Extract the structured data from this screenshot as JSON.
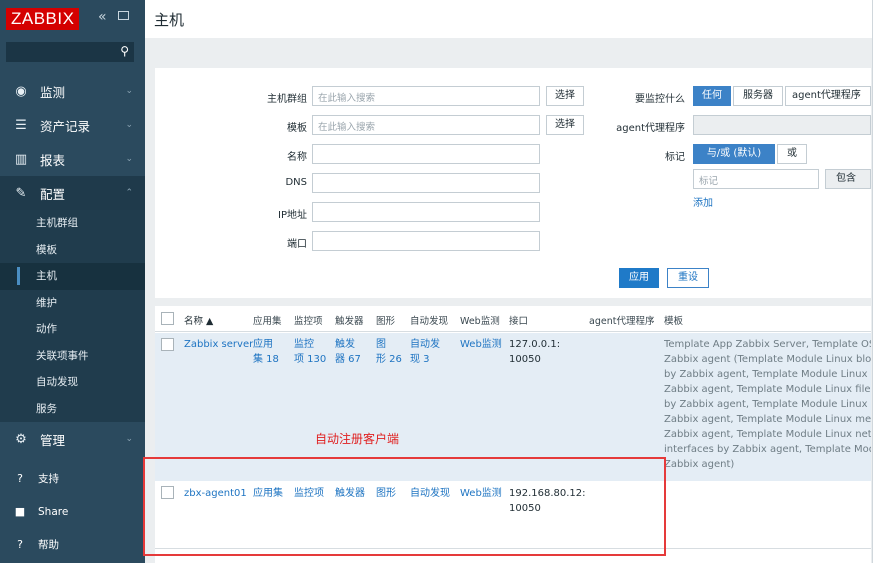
{
  "sidebar": {
    "logo": "ZABBIX",
    "nav": [
      {
        "label": "监测",
        "icon": "eye-icon"
      },
      {
        "label": "资产记录",
        "icon": "list-icon"
      },
      {
        "label": "报表",
        "icon": "bar-chart-icon"
      },
      {
        "label": "配置",
        "icon": "wrench-icon"
      }
    ],
    "config_sub": [
      "主机群组",
      "模板",
      "主机",
      "维护",
      "动作",
      "关联项事件",
      "自动发现",
      "服务"
    ],
    "admin": {
      "label": "管理",
      "icon": "gear-icon"
    },
    "bottom": [
      {
        "label": "支持",
        "icon": "support-icon"
      },
      {
        "label": "Share",
        "icon": "share-icon"
      },
      {
        "label": "帮助",
        "icon": "help-icon"
      }
    ]
  },
  "page": {
    "title": "主机"
  },
  "filter": {
    "host_group_label": "主机群组",
    "host_group_placeholder": "在此输入搜索",
    "select_btn": "选择",
    "template_label": "模板",
    "template_placeholder": "在此输入搜索",
    "name_label": "名称",
    "dns_label": "DNS",
    "ip_label": "IP地址",
    "port_label": "端口",
    "monitored_by_label": "要监控什么",
    "monitored_by_options": [
      "任何",
      "服务器",
      "agent代理程序"
    ],
    "proxy_label": "agent代理程序",
    "tags_label": "标记",
    "tags_options": [
      "与/或 (默认)",
      "或"
    ],
    "tag_placeholder": "标记",
    "tag_operator": "包含",
    "add_link": "添加",
    "apply_btn": "应用",
    "reset_btn": "重设"
  },
  "table": {
    "headers": [
      "名称 ▲",
      "应用集",
      "监控项",
      "触发器",
      "图形",
      "自动发现",
      "Web监测",
      "接口",
      "agent代理程序",
      "模板"
    ],
    "rows": [
      {
        "name": "Zabbix server",
        "apps": [
          "应用",
          "集 18"
        ],
        "items": [
          "监控",
          "项 130"
        ],
        "triggers": [
          "触发",
          "器 67"
        ],
        "graphs": [
          "图",
          "形 26"
        ],
        "discovery": [
          "自动发",
          "现 3"
        ],
        "web": "Web监测",
        "iface": [
          "127.0.0.1:",
          "10050"
        ],
        "templates": [
          "Template App Zabbix Server, Template OS",
          "Zabbix agent (Template Module Linux bloc",
          "by Zabbix agent, Template Module Linux C",
          "Zabbix agent, Template Module Linux files",
          "by Zabbix agent, Template Module Linux g",
          "Zabbix agent, Template Module Linux mem",
          "Zabbix agent, Template Module Linux netw",
          "interfaces by Zabbix agent, Template Modu",
          "Zabbix agent)"
        ]
      },
      {
        "name": "zbx-agent01",
        "apps": "应用集",
        "items": "监控项",
        "triggers": "触发器",
        "graphs": "图形",
        "discovery": "自动发现",
        "web": "Web监测",
        "iface": [
          "192.168.80.12:",
          "10050"
        ]
      }
    ]
  },
  "annotation": "自动注册客户端",
  "colors": {
    "sidebar": "#2b4a5e",
    "accent": "#1f7ac8",
    "annotation": "#e02020"
  }
}
